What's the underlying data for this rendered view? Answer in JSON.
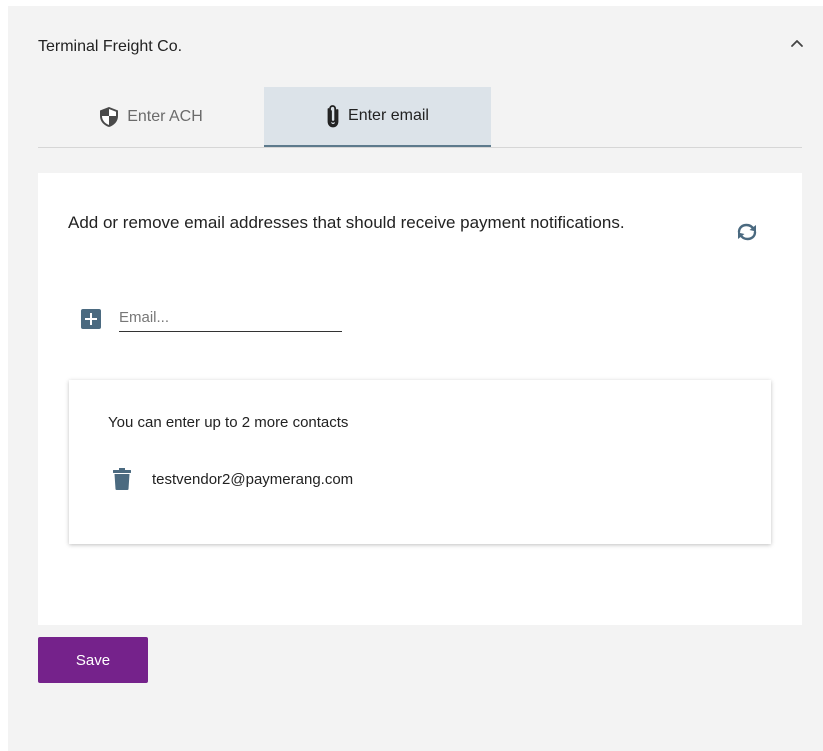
{
  "header": {
    "title": "Terminal Freight Co."
  },
  "tabs": [
    {
      "label": "Enter ACH",
      "icon": "shield-icon",
      "active": false
    },
    {
      "label": "Enter email",
      "icon": "paperclip-icon",
      "active": true
    }
  ],
  "main": {
    "description": "Add or remove email addresses that should receive payment notifications.",
    "email_input": {
      "value": "",
      "placeholder": "Email..."
    },
    "contacts": {
      "note": "You can enter up to 2 more contacts",
      "items": [
        {
          "email": "testvendor2@paymerang.com"
        }
      ]
    }
  },
  "footer": {
    "save_label": "Save"
  },
  "colors": {
    "accent": "#75228b",
    "active_tab_bg": "#dce3e9",
    "icon_slate": "#4b6a80"
  }
}
